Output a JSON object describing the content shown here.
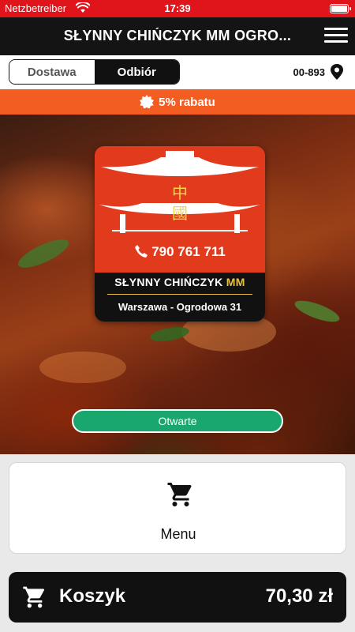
{
  "status_bar": {
    "carrier": "Netzbetreiber",
    "time": "17:39"
  },
  "header": {
    "title": "SŁYNNY CHIŃCZYK MM OGRO..."
  },
  "order_mode": {
    "options": [
      "Dostawa",
      "Odbiór"
    ],
    "selected": "Odbiór"
  },
  "location": {
    "postcode": "00-893"
  },
  "discount": {
    "text": "5% rabatu"
  },
  "restaurant": {
    "logo_chars": "中國",
    "phone": "790 761 711",
    "name": "SŁYNNY CHIŃCZYK",
    "name_mark": "MM",
    "city_line": "Warszawa - Ogrodowa 31",
    "status": "Otwarte"
  },
  "menu_card": {
    "label": "Menu"
  },
  "cart": {
    "label": "Koszyk",
    "total": "70,30 zł"
  },
  "colors": {
    "status_bar": "#e0141b",
    "header": "#141414",
    "discount": "#f45d21",
    "logo_red": "#e23a1d",
    "open_badge": "#1aa76e",
    "gold": "#e8c14a"
  }
}
